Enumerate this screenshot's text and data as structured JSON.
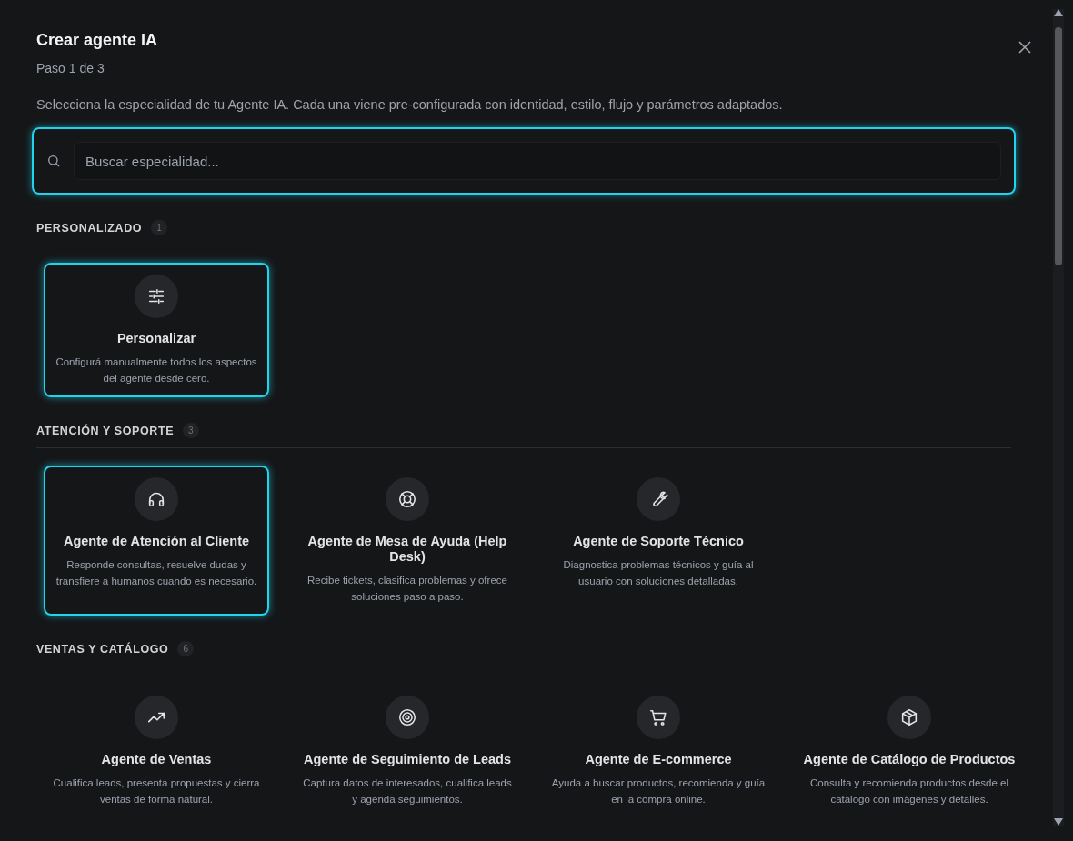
{
  "dialog": {
    "title": "Crear agente IA",
    "step": "Paso 1 de 3",
    "intro": "Selecciona la especialidad de tu Agente IA. Cada una viene pre-configurada con identidad, estilo, flujo y parámetros adaptados."
  },
  "search": {
    "placeholder": "Buscar especialidad...",
    "focused": true
  },
  "sections": [
    {
      "title": "PERSONALIZADO",
      "count": "1",
      "cards": [
        {
          "title": "Personalizar",
          "description": "Configurá manualmente todos los aspectos del agente desde cero.",
          "highlighted": true
        }
      ]
    },
    {
      "title": "ATENCIÓN Y SOPORTE",
      "count": "3",
      "cards": [
        {
          "title": "Agente de Atención al Cliente",
          "description": "Responde consultas, resuelve dudas y transfiere a humanos cuando es necesario.",
          "highlighted": true
        },
        {
          "title": "Agente de Mesa de Ayuda (Help Desk)",
          "description": "Recibe tickets, clasifica problemas y ofrece soluciones paso a paso.",
          "highlighted": false
        },
        {
          "title": "Agente de Soporte Técnico",
          "description": "Diagnostica problemas técnicos y guía al usuario con soluciones detalladas.",
          "highlighted": false
        }
      ]
    },
    {
      "title": "VENTAS Y CATÁLOGO",
      "count": "6",
      "cards": [
        {
          "title": "Agente de Ventas",
          "description": "Cualifica leads, presenta propuestas y cierra ventas de forma natural.",
          "highlighted": false
        },
        {
          "title": "Agente de Seguimiento de Leads",
          "description": "Captura datos de interesados, cualifica leads y agenda seguimientos.",
          "highlighted": false
        },
        {
          "title": "Agente de E-commerce",
          "description": "Ayuda a buscar productos, recomienda y guía en la compra online.",
          "highlighted": false
        },
        {
          "title": "Agente de Catálogo de Productos",
          "description": "Consulta y recomienda productos desde el catálogo con imágenes y detalles.",
          "highlighted": false
        }
      ]
    }
  ]
}
